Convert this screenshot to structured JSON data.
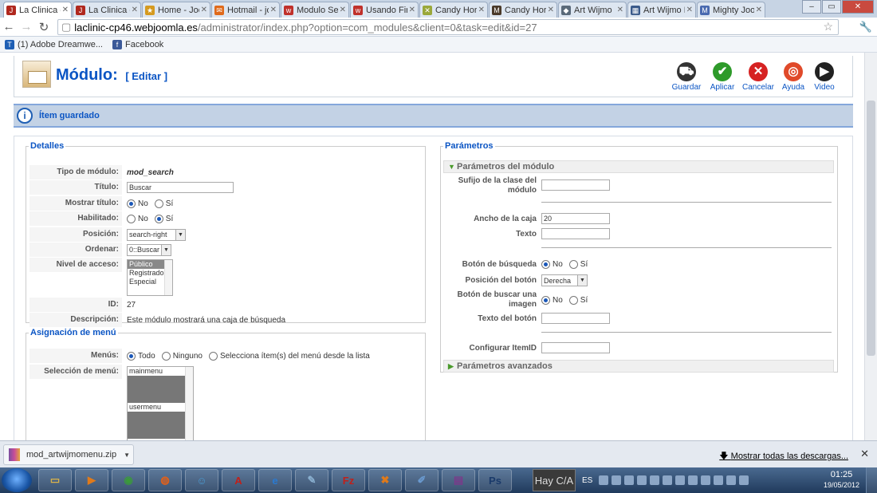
{
  "browser": {
    "tabs": [
      {
        "label": "La Clinica d",
        "color": "#b0281e",
        "glyph": "J",
        "active": true
      },
      {
        "label": "La Clinica d",
        "color": "#b0281e",
        "glyph": "J"
      },
      {
        "label": "Home - Joo",
        "color": "#d59a20",
        "glyph": "★"
      },
      {
        "label": "Hotmail - jo",
        "color": "#e06a1b",
        "glyph": "✉"
      },
      {
        "label": "Modulo Se",
        "color": "#c0302a",
        "glyph": "w"
      },
      {
        "label": "Usando Fire",
        "color": "#c0302a",
        "glyph": "w"
      },
      {
        "label": "Candy Hori",
        "color": "#9aa83a",
        "glyph": "✕"
      },
      {
        "label": "Candy Hori",
        "color": "#4a3a2a",
        "glyph": "M"
      },
      {
        "label": "Art Wijmo",
        "color": "#5a6a7a",
        "glyph": "◆"
      },
      {
        "label": "Art Wijmo M",
        "color": "#3a5a8a",
        "glyph": "▦"
      },
      {
        "label": "Mighty Joo",
        "color": "#4a6ab0",
        "glyph": "M"
      }
    ],
    "url_host": "laclinic-cp46.webjoomla.es",
    "url_path": "/administrator/index.php?option=com_modules&client=0&task=edit&id=27",
    "bookmarks": [
      {
        "label": "(1) Adobe Dreamwe...",
        "color": "#1f5fb4",
        "glyph": "T"
      },
      {
        "label": "Facebook",
        "color": "#3b5998",
        "glyph": "f"
      }
    ]
  },
  "toolbar": {
    "title": "Módulo:",
    "subtitle": "[ Editar ]",
    "buttons": [
      {
        "label": "Guardar",
        "color": "#333",
        "glyph": "⛟"
      },
      {
        "label": "Aplicar",
        "color": "#2e9a2a",
        "glyph": "✔"
      },
      {
        "label": "Cancelar",
        "color": "#d62222",
        "glyph": "✕"
      },
      {
        "label": "Ayuda",
        "color": "#e04a2a",
        "glyph": "◎"
      },
      {
        "label": "Video",
        "color": "#222",
        "glyph": "▶"
      }
    ]
  },
  "message": "Ítem guardado",
  "details": {
    "legend": "Detalles",
    "tipo_label": "Tipo de módulo:",
    "tipo_value": "mod_search",
    "titulo_label": "Título:",
    "titulo_value": "Buscar",
    "mostrar_label": "Mostrar título:",
    "habilitado_label": "Habilitado:",
    "opt_no": "No",
    "opt_si": "Sí",
    "posicion_label": "Posición:",
    "posicion_value": "search-right",
    "ordenar_label": "Ordenar:",
    "ordenar_value": "0::Buscar",
    "acceso_label": "Nivel de acceso:",
    "acceso_options": [
      "Público",
      "Registrado",
      "Especial"
    ],
    "id_label": "ID:",
    "id_value": "27",
    "desc_label": "Descripción:",
    "desc_value": "Este módulo mostrará una caja de búsqueda"
  },
  "menu": {
    "legend": "Asignación de menú",
    "menus_label": "Menús:",
    "opt_todo": "Todo",
    "opt_ninguno": "Ninguno",
    "opt_selecciona": "Selecciona ítem(s) del menú desde la lista",
    "seleccion_label": "Selección de menú:",
    "list": [
      "mainmenu",
      "usermenu"
    ]
  },
  "params": {
    "legend": "Parámetros",
    "module_header": "Parámetros del módulo",
    "sufijo_label": "Sufijo de la clase del módulo",
    "ancho_label": "Ancho de la caja",
    "ancho_value": "20",
    "texto_label": "Texto",
    "boton_busqueda_label": "Botón de búsqueda",
    "opt_no": "No",
    "opt_si": "Sí",
    "posicion_boton_label": "Posición del botón",
    "posicion_boton_value": "Derecha",
    "boton_imagen_label": "Botón de buscar una imagen",
    "texto_boton_label": "Texto del botón",
    "itemid_label": "Configurar ItemID",
    "advanced_header": "Parámetros avanzados"
  },
  "downloads": {
    "file": "mod_artwijmomenu.zip",
    "show_all": "Mostrar todas las descargas..."
  },
  "taskbar": {
    "apps": [
      {
        "name": "explorer",
        "glyph": "▭",
        "color": "#d9b24a"
      },
      {
        "name": "media",
        "glyph": "▶",
        "color": "#e07a1a"
      },
      {
        "name": "chrome",
        "glyph": "◉",
        "color": "#3a9a3a"
      },
      {
        "name": "firefox",
        "glyph": "◍",
        "color": "#e0601a"
      },
      {
        "name": "messenger",
        "glyph": "☺",
        "color": "#4a9ad0"
      },
      {
        "name": "acrobat",
        "glyph": "A",
        "color": "#c0201a"
      },
      {
        "name": "ie",
        "glyph": "e",
        "color": "#2a7ad0"
      },
      {
        "name": "notes",
        "glyph": "✎",
        "color": "#8ab0d0"
      },
      {
        "name": "filezilla",
        "glyph": "Fz",
        "color": "#c0201a"
      },
      {
        "name": "xampp",
        "glyph": "✖",
        "color": "#e07a1a"
      },
      {
        "name": "paint",
        "glyph": "✐",
        "color": "#6a9ad0"
      },
      {
        "name": "winrar",
        "glyph": "▤",
        "color": "#7a3a8a"
      },
      {
        "name": "photoshop",
        "glyph": "Ps",
        "color": "#1a3a6a"
      }
    ],
    "hay": "Hay C/A",
    "lang": "ES",
    "time": "01:25",
    "date": "19/05/2012"
  }
}
